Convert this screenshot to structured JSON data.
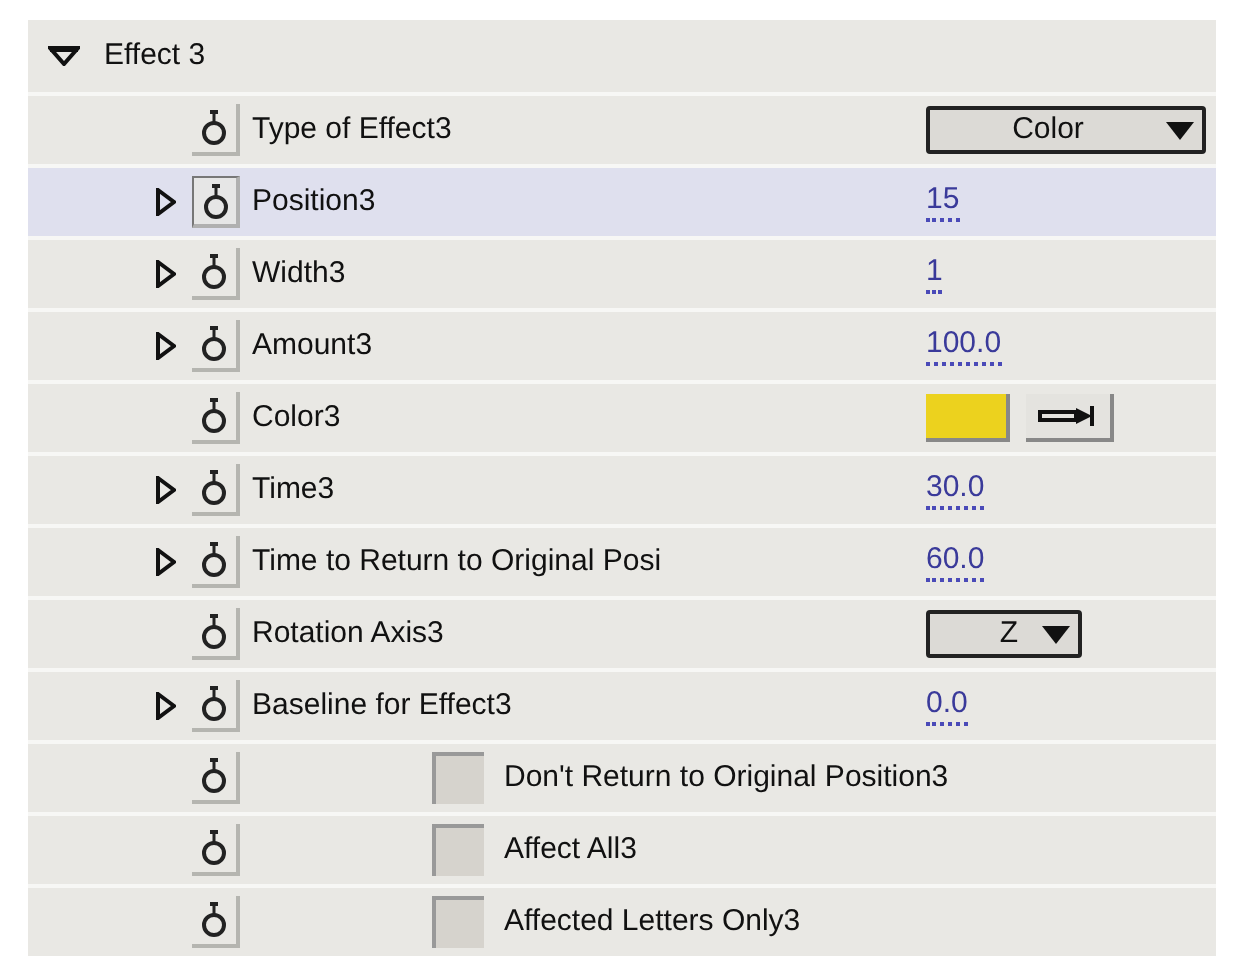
{
  "group": {
    "title": "Effect 3",
    "expanded": true
  },
  "rows": [
    {
      "kind": "dropdown",
      "label": "Type of Effect3",
      "expandable": false,
      "selected": false,
      "value": "Color",
      "wide": true
    },
    {
      "kind": "number",
      "label": "Position3",
      "expandable": true,
      "selected": true,
      "value": "15"
    },
    {
      "kind": "number",
      "label": "Width3",
      "expandable": true,
      "selected": false,
      "value": "1"
    },
    {
      "kind": "number",
      "label": "Amount3",
      "expandable": true,
      "selected": false,
      "value": "100.0"
    },
    {
      "kind": "color",
      "label": "Color3",
      "expandable": false,
      "selected": false,
      "color": "#ecd21e"
    },
    {
      "kind": "number",
      "label": "Time3",
      "expandable": true,
      "selected": false,
      "value": "30.0"
    },
    {
      "kind": "number",
      "label": "Time to Return to Original Posi",
      "expandable": true,
      "selected": false,
      "value": "60.0"
    },
    {
      "kind": "dropdown",
      "label": "Rotation Axis3",
      "expandable": false,
      "selected": false,
      "value": "Z",
      "wide": false
    },
    {
      "kind": "number",
      "label": "Baseline for Effect3",
      "expandable": true,
      "selected": false,
      "value": "0.0"
    },
    {
      "kind": "checkbox",
      "label": "Don't Return to Original Position3",
      "selected": false,
      "checked": false
    },
    {
      "kind": "checkbox",
      "label": "Affect All3",
      "selected": false,
      "checked": false
    },
    {
      "kind": "checkbox",
      "label": "Affected Letters Only3",
      "selected": false,
      "checked": false
    }
  ]
}
